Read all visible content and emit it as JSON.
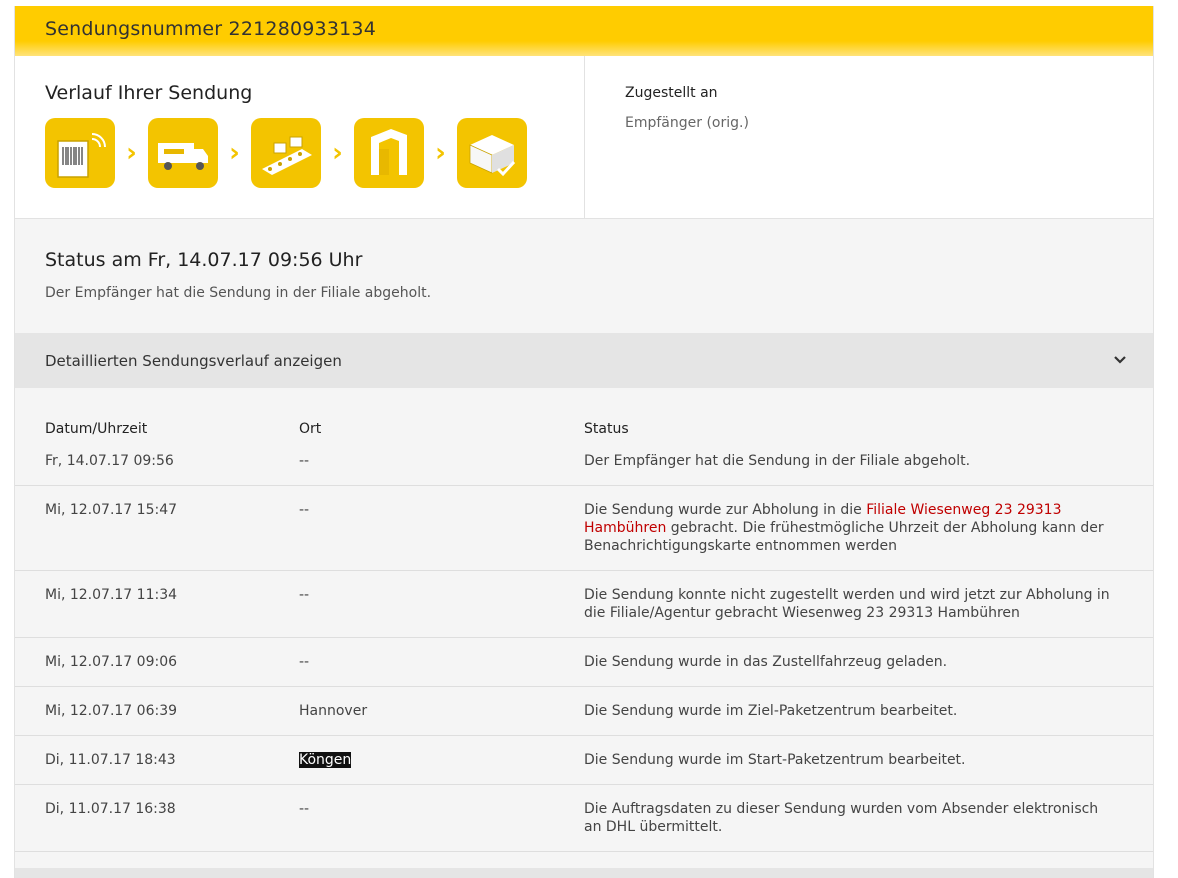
{
  "header": {
    "title": "Sendungsnummer 221280933134"
  },
  "progress": {
    "title": "Verlauf Ihrer Sendung",
    "steps": [
      {
        "icon": "parcel-barcode-icon"
      },
      {
        "icon": "dhl-truck-icon"
      },
      {
        "icon": "conveyor-icon"
      },
      {
        "icon": "gate-icon"
      },
      {
        "icon": "delivered-box-check-icon"
      }
    ]
  },
  "delivery": {
    "label": "Zugestellt an",
    "value": "Empfänger (orig.)"
  },
  "status": {
    "title": "Status am Fr, 14.07.17 09:56 Uhr",
    "text": "Der Empfänger hat die Sendung in der Filiale abgeholt."
  },
  "toggle": {
    "label": "Detaillierten Sendungsverlauf anzeigen"
  },
  "history": {
    "headers": {
      "date": "Datum/Uhrzeit",
      "place": "Ort",
      "status": "Status"
    },
    "rows": [
      {
        "date": "Fr, 14.07.17 09:56",
        "place": "--",
        "status": "Der Empfänger hat die Sendung in der Filiale abgeholt."
      },
      {
        "date": "Mi, 12.07.17 15:47",
        "place": "--",
        "status_pre": "Die Sendung wurde zur Abholung in die ",
        "status_link": "Filiale Wiesenweg 23 29313 Hambühren",
        "status_post": " gebracht. Die frühestmögliche Uhrzeit der Abholung kann der Benachrichtigungskarte entnommen werden"
      },
      {
        "date": "Mi, 12.07.17 11:34",
        "place": "--",
        "status": "Die Sendung konnte nicht zugestellt werden und wird jetzt zur Abholung in die Filiale/Agentur gebracht Wiesenweg 23 29313 Hambühren"
      },
      {
        "date": "Mi, 12.07.17 09:06",
        "place": "--",
        "status": "Die Sendung wurde in das Zustellfahrzeug geladen."
      },
      {
        "date": "Mi, 12.07.17 06:39",
        "place": "Hannover",
        "status": "Die Sendung wurde im Ziel-Paketzentrum bearbeitet."
      },
      {
        "date": "Di, 11.07.17 18:43",
        "place": "Köngen",
        "status": "Die Sendung wurde im Start-Paketzentrum bearbeitet."
      },
      {
        "date": "Di, 11.07.17 16:38",
        "place": "--",
        "status": "Die Auftragsdaten zu dieser Sendung wurden vom Absender elektronisch an DHL übermittelt."
      }
    ]
  },
  "colors": {
    "yellow": "#ffcc00",
    "link": "#c00000"
  }
}
